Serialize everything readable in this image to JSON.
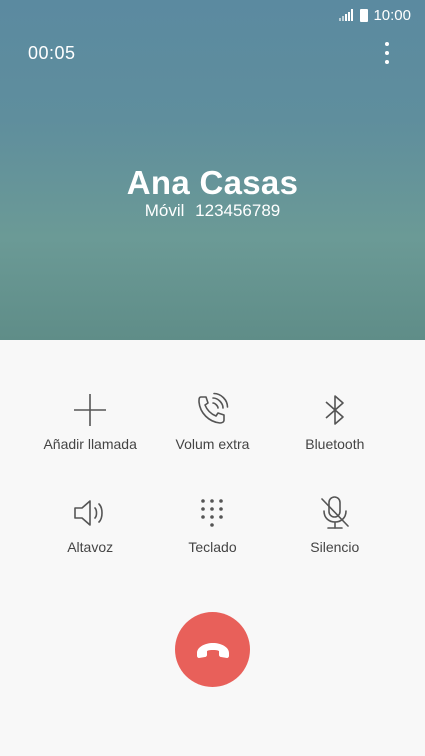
{
  "status_bar": {
    "time": "10:00"
  },
  "call": {
    "duration": "00:05",
    "caller_name": "Ana Casas",
    "number_type": "Móvil",
    "number": "123456789"
  },
  "actions": [
    {
      "label": "Añadir llamada",
      "icon": "plus-icon"
    },
    {
      "label": "Volum extra",
      "icon": "phone-volume-icon"
    },
    {
      "label": "Bluetooth",
      "icon": "bluetooth-icon"
    },
    {
      "label": "Altavoz",
      "icon": "speaker-icon"
    },
    {
      "label": "Teclado",
      "icon": "keypad-icon"
    },
    {
      "label": "Silencio",
      "icon": "mic-off-icon"
    }
  ],
  "colors": {
    "header": "#5f8e9d",
    "end_call": "#e8605a",
    "label": "#444444"
  }
}
